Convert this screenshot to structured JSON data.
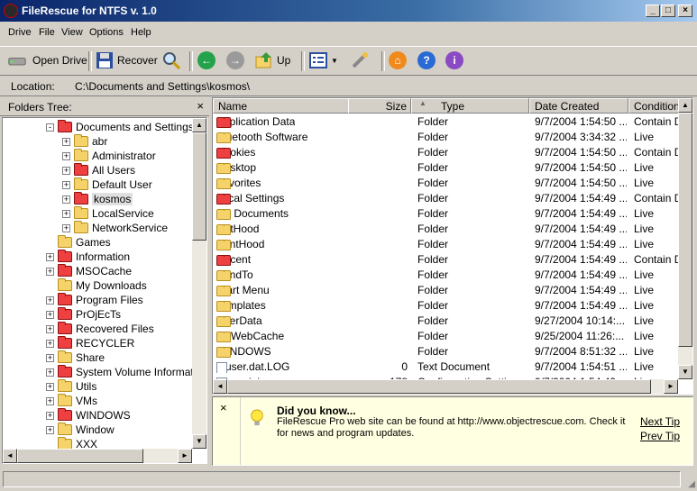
{
  "window": {
    "title": "FileRescue for NTFS v. 1.0"
  },
  "menu": [
    "Drive",
    "File",
    "View",
    "Options",
    "Help"
  ],
  "toolbar": {
    "open_drive": "Open Drive",
    "recover": "Recover",
    "up": "Up"
  },
  "location": {
    "label": "Location:",
    "path": "C:\\Documents and Settings\\kosmos\\"
  },
  "folders_tree": {
    "title": "Folders Tree:",
    "items": [
      {
        "label": "Documents and Settings",
        "level": 1,
        "expand": "-",
        "color": "r"
      },
      {
        "label": "abr",
        "level": 2,
        "expand": "+",
        "color": "y"
      },
      {
        "label": "Administrator",
        "level": 2,
        "expand": "+",
        "color": "y"
      },
      {
        "label": "All Users",
        "level": 2,
        "expand": "+",
        "color": "r"
      },
      {
        "label": "Default User",
        "level": 2,
        "expand": "+",
        "color": "y"
      },
      {
        "label": "kosmos",
        "level": 2,
        "expand": "+",
        "color": "r",
        "selected": true
      },
      {
        "label": "LocalService",
        "level": 2,
        "expand": "+",
        "color": "y"
      },
      {
        "label": "NetworkService",
        "level": 2,
        "expand": "+",
        "color": "y"
      },
      {
        "label": "Games",
        "level": 1,
        "expand": "",
        "color": "y"
      },
      {
        "label": "Information",
        "level": 1,
        "expand": "+",
        "color": "r"
      },
      {
        "label": "MSOCache",
        "level": 1,
        "expand": "+",
        "color": "r"
      },
      {
        "label": "My Downloads",
        "level": 1,
        "expand": "",
        "color": "y"
      },
      {
        "label": "Program Files",
        "level": 1,
        "expand": "+",
        "color": "r"
      },
      {
        "label": "PrOjEcTs",
        "level": 1,
        "expand": "+",
        "color": "r"
      },
      {
        "label": "Recovered Files",
        "level": 1,
        "expand": "+",
        "color": "r"
      },
      {
        "label": "RECYCLER",
        "level": 1,
        "expand": "+",
        "color": "r"
      },
      {
        "label": "Share",
        "level": 1,
        "expand": "+",
        "color": "y"
      },
      {
        "label": "System Volume Information",
        "level": 1,
        "expand": "+",
        "color": "r"
      },
      {
        "label": "Utils",
        "level": 1,
        "expand": "+",
        "color": "y"
      },
      {
        "label": "VMs",
        "level": 1,
        "expand": "+",
        "color": "y"
      },
      {
        "label": "WINDOWS",
        "level": 1,
        "expand": "+",
        "color": "r"
      },
      {
        "label": "Window",
        "level": 1,
        "expand": "+",
        "color": "y"
      },
      {
        "label": "XXX",
        "level": 1,
        "expand": "",
        "color": "y"
      }
    ]
  },
  "file_list": {
    "columns": [
      "Name",
      "Size",
      "Type",
      "Date Created",
      "Condition"
    ],
    "rows": [
      {
        "icon": "r",
        "name": "Application Data",
        "size": "",
        "type": "Folder",
        "date": "9/7/2004 1:54:50 ...",
        "condition": "Contain D..."
      },
      {
        "icon": "y",
        "name": "Bluetooth Software",
        "size": "",
        "type": "Folder",
        "date": "9/7/2004 3:34:32 ...",
        "condition": "Live"
      },
      {
        "icon": "r",
        "name": "Cookies",
        "size": "",
        "type": "Folder",
        "date": "9/7/2004 1:54:50 ...",
        "condition": "Contain D..."
      },
      {
        "icon": "y",
        "name": "Desktop",
        "size": "",
        "type": "Folder",
        "date": "9/7/2004 1:54:50 ...",
        "condition": "Live"
      },
      {
        "icon": "y",
        "name": "Favorites",
        "size": "",
        "type": "Folder",
        "date": "9/7/2004 1:54:50 ...",
        "condition": "Live"
      },
      {
        "icon": "r",
        "name": "Local Settings",
        "size": "",
        "type": "Folder",
        "date": "9/7/2004 1:54:49 ...",
        "condition": "Contain D..."
      },
      {
        "icon": "y",
        "name": "My Documents",
        "size": "",
        "type": "Folder",
        "date": "9/7/2004 1:54:49 ...",
        "condition": "Live"
      },
      {
        "icon": "y",
        "name": "NetHood",
        "size": "",
        "type": "Folder",
        "date": "9/7/2004 1:54:49 ...",
        "condition": "Live"
      },
      {
        "icon": "y",
        "name": "PrintHood",
        "size": "",
        "type": "Folder",
        "date": "9/7/2004 1:54:49 ...",
        "condition": "Live"
      },
      {
        "icon": "r",
        "name": "Recent",
        "size": "",
        "type": "Folder",
        "date": "9/7/2004 1:54:49 ...",
        "condition": "Contain D..."
      },
      {
        "icon": "y",
        "name": "SendTo",
        "size": "",
        "type": "Folder",
        "date": "9/7/2004 1:54:49 ...",
        "condition": "Live"
      },
      {
        "icon": "y",
        "name": "Start Menu",
        "size": "",
        "type": "Folder",
        "date": "9/7/2004 1:54:49 ...",
        "condition": "Live"
      },
      {
        "icon": "y",
        "name": "Templates",
        "size": "",
        "type": "Folder",
        "date": "9/7/2004 1:54:49 ...",
        "condition": "Live"
      },
      {
        "icon": "y",
        "name": "UserData",
        "size": "",
        "type": "Folder",
        "date": "9/27/2004 10:14:...",
        "condition": "Live"
      },
      {
        "icon": "y",
        "name": "VSWebCache",
        "size": "",
        "type": "Folder",
        "date": "9/25/2004 11:26:...",
        "condition": "Live"
      },
      {
        "icon": "y",
        "name": "WINDOWS",
        "size": "",
        "type": "Folder",
        "date": "9/7/2004 8:51:32 ...",
        "condition": "Live"
      },
      {
        "icon": "doc",
        "name": "ntuser.dat.LOG",
        "size": "0",
        "type": "Text Document",
        "date": "9/7/2004 1:54:51 ...",
        "condition": "Live"
      },
      {
        "icon": "doc",
        "name": "ntuser.ini",
        "size": "178",
        "type": "Configuration Settings",
        "date": "9/7/2004 1:54:49 ...",
        "condition": "Live"
      }
    ]
  },
  "tip": {
    "title": "Did you know...",
    "text_line1": "FileRescue Pro web site can be found at http://www.objectrescue.com. Check it",
    "text_line2": "for news and program updates.",
    "next": "Next Tip",
    "prev": "Prev Tip"
  },
  "colors": {
    "title_start": "#0a246a",
    "title_end": "#a6caf0",
    "tip_bg": "#ffffe1",
    "window_bg": "#d4d0c8"
  }
}
